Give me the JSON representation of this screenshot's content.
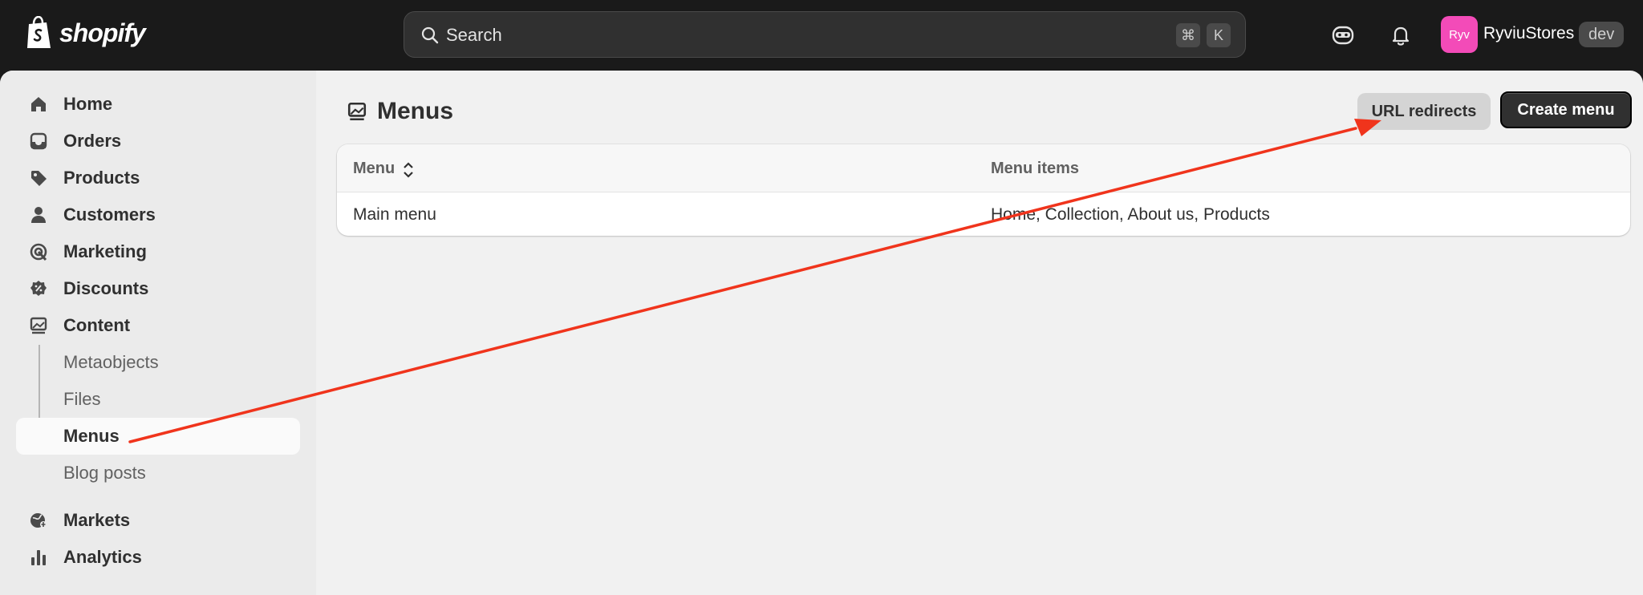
{
  "topbar": {
    "logo_text": "shopify",
    "search_placeholder": "Search",
    "shortcut_cmd": "⌘",
    "shortcut_key": "K",
    "avatar_initials": "Ryv",
    "store_name": "RyviuStores",
    "store_badge": "dev"
  },
  "sidebar": {
    "items": [
      {
        "label": "Home",
        "icon": "home-icon"
      },
      {
        "label": "Orders",
        "icon": "inbox-icon"
      },
      {
        "label": "Products",
        "icon": "tag-icon"
      },
      {
        "label": "Customers",
        "icon": "person-icon"
      },
      {
        "label": "Marketing",
        "icon": "target-icon"
      },
      {
        "label": "Discounts",
        "icon": "discount-icon"
      },
      {
        "label": "Content",
        "icon": "image-icon"
      }
    ],
    "sub_items": [
      {
        "label": "Metaobjects"
      },
      {
        "label": "Files"
      },
      {
        "label": "Menus",
        "active": true
      },
      {
        "label": "Blog posts"
      }
    ],
    "items_bottom": [
      {
        "label": "Markets",
        "icon": "globe-icon"
      },
      {
        "label": "Analytics",
        "icon": "bar-chart-icon"
      }
    ]
  },
  "main": {
    "title": "Menus",
    "buttons": {
      "secondary": "URL redirects",
      "primary": "Create menu"
    },
    "table": {
      "headers": [
        "Menu",
        "Menu items"
      ],
      "rows": [
        [
          "Main menu",
          "Home, Collection, About us, Products"
        ]
      ]
    }
  },
  "colors": {
    "topbar": "#1a1a1a",
    "annotation_arrow": "#f0341c",
    "avatar": "#f34bb8"
  }
}
